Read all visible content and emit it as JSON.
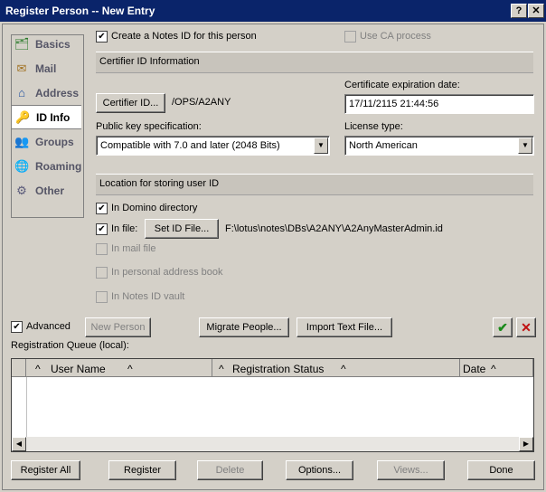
{
  "window": {
    "title": "Register Person -- New Entry",
    "help_btn": "?",
    "close_btn": "✕"
  },
  "sidebar": {
    "items": [
      {
        "label": "Basics",
        "icon": "🗂"
      },
      {
        "label": "Mail",
        "icon": "✉"
      },
      {
        "label": "Address",
        "icon": "⌂"
      },
      {
        "label": "ID Info",
        "icon": "🔑"
      },
      {
        "label": "Groups",
        "icon": "👥"
      },
      {
        "label": "Roaming",
        "icon": "🌐"
      },
      {
        "label": "Other",
        "icon": "⚙"
      }
    ]
  },
  "top": {
    "create_notes_id": "Create a Notes ID for this person",
    "use_ca_process": "Use CA process"
  },
  "certifier": {
    "section_title": "Certifier ID Information",
    "cert_exp_label": "Certificate expiration date:",
    "cert_exp_value": "17/11/2115 21:44:56",
    "certifier_btn": "Certifier ID...",
    "certifier_name": "/OPS/A2ANY",
    "pubkey_label": "Public key specification:",
    "pubkey_value": "Compatible with 7.0 and later (2048 Bits)",
    "license_label": "License type:",
    "license_value": "North American"
  },
  "location": {
    "section_title": "Location for storing user ID",
    "in_domino": "In Domino directory",
    "in_file": "In file:",
    "set_id_btn": "Set ID File...",
    "file_path": "F:\\lotus\\notes\\DBs\\A2ANY\\A2AnyMasterAdmin.id",
    "in_mail_file": "In mail file",
    "in_pab": "In personal address book",
    "in_vault": "In Notes ID vault"
  },
  "actions": {
    "advanced": "Advanced",
    "new_person": "New Person",
    "migrate": "Migrate People...",
    "import": "Import Text File...",
    "ok_icon": "✔",
    "cancel_icon": "✕"
  },
  "queue": {
    "label": "Registration Queue (local):",
    "sort_glyph": "^",
    "columns": [
      "User Name",
      "Registration Status",
      "Date"
    ]
  },
  "bottom": {
    "register_all": "Register All",
    "register": "Register",
    "delete": "Delete",
    "options": "Options...",
    "views": "Views...",
    "done": "Done"
  }
}
